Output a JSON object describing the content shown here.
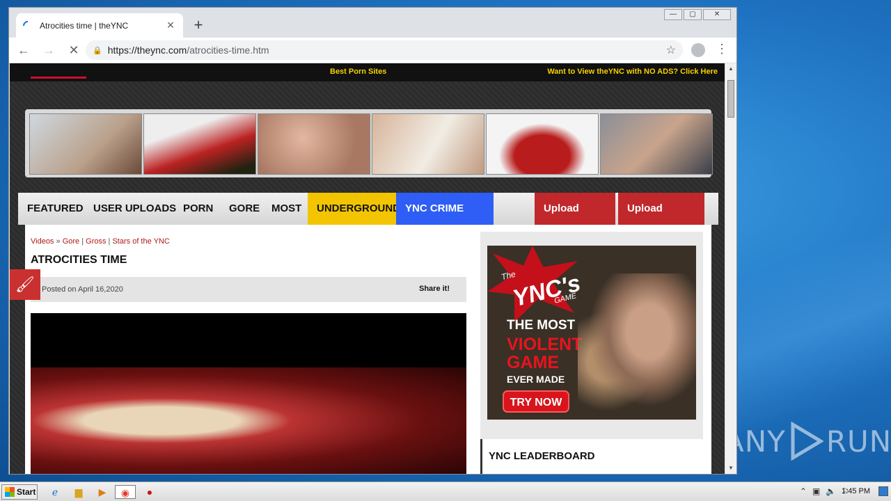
{
  "browser": {
    "tab_title": "Atrocities time | theYNC",
    "new_tab": "+",
    "url_host": "https://theync.com",
    "url_path": "/atrocities-time.htm",
    "min": "—",
    "max": "▢",
    "close": "✕",
    "back": "←",
    "forward": "→",
    "reload": "✕",
    "star": "☆",
    "menu": "⋮",
    "tab_close": "✕"
  },
  "site": {
    "topbar_mid": "Best Porn Sites",
    "topbar_right": "Want to View theYNC with NO ADS? Click Here",
    "nav": [
      "FEATURED",
      "USER UPLOADS",
      "PORN",
      "GORE",
      "MOST",
      "UNDERGROUND",
      "YNC CRIME BLOG"
    ],
    "upload_video": "Upload Video",
    "upload_photos": "Upload Photos",
    "breadcrumbs": [
      "Videos",
      "»",
      "Gore",
      "|",
      "Gross",
      "|",
      "Stars of the YNC"
    ],
    "title": "ATROCITIES TIME",
    "posted": "Posted on April 16,2020",
    "share": "Share it!",
    "ad": {
      "the": "The",
      "brand": "YNC's",
      "game": "GAME",
      "l1": "THE MOST",
      "l2": "VIOLENT",
      "l3": "GAME",
      "l4": "EVER MADE",
      "cta": "TRY NOW"
    },
    "leaderboard": "YNC LEADERBOARD"
  },
  "taskbar": {
    "start": "Start",
    "clock": "1:45 PM"
  },
  "watermark": {
    "left": "ANY",
    "right": "RUN"
  },
  "colors": {
    "accent_red": "#c0282c",
    "underground_yellow": "#f2c500",
    "crime_blue": "#2e5ef5",
    "topbar_text": "#f5d300"
  }
}
